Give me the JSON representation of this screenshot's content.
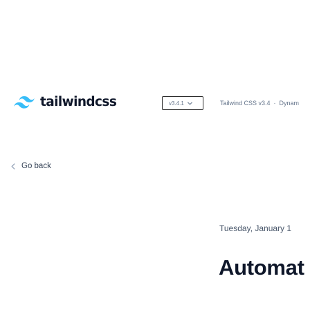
{
  "header": {
    "logo_text": "tailwindcss",
    "version": "v3.4.1",
    "link_title": "Tailwind CSS v3.4",
    "link_separator": "·",
    "link_subtitle": "Dynam"
  },
  "nav": {
    "back_label": "Go back"
  },
  "post": {
    "date": "Tuesday, January 1",
    "title": "Automat"
  },
  "colors": {
    "brand": "#38bdf8",
    "heading": "#0f172a",
    "muted": "#64748b"
  },
  "icons": {
    "logo": "tailwind-logo-icon",
    "version_chevron": "chevron-down-icon",
    "back": "chevron-left-icon"
  }
}
